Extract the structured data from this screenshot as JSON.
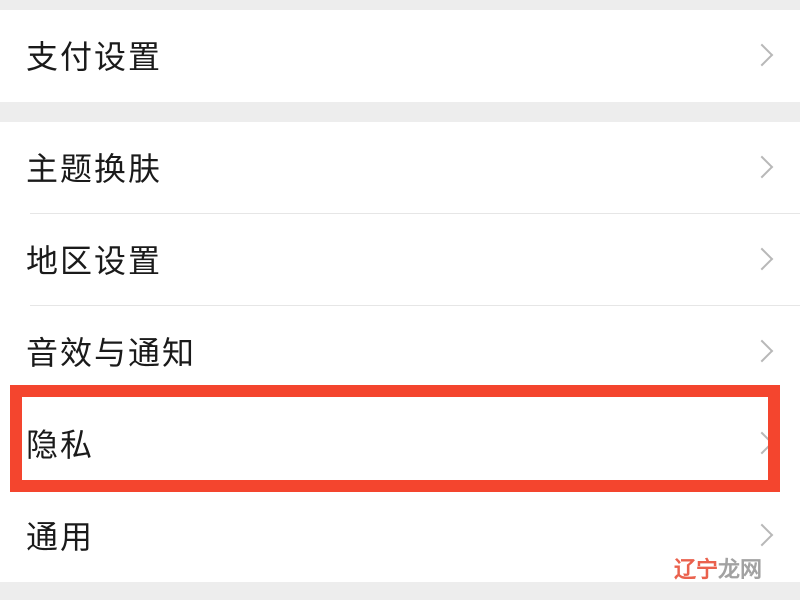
{
  "settings": {
    "group1": [
      {
        "label": "支付设置"
      }
    ],
    "group2": [
      {
        "label": "主题换肤"
      },
      {
        "label": "地区设置"
      },
      {
        "label": "音效与通知"
      },
      {
        "label": "隐私"
      },
      {
        "label": "通用"
      }
    ]
  },
  "watermark": {
    "text_main": "辽宁",
    "text_tail": "龙网"
  },
  "colors": {
    "highlight": "#f4452e",
    "background": "#ededed",
    "row": "#ffffff"
  },
  "highlighted_item": "隐私"
}
